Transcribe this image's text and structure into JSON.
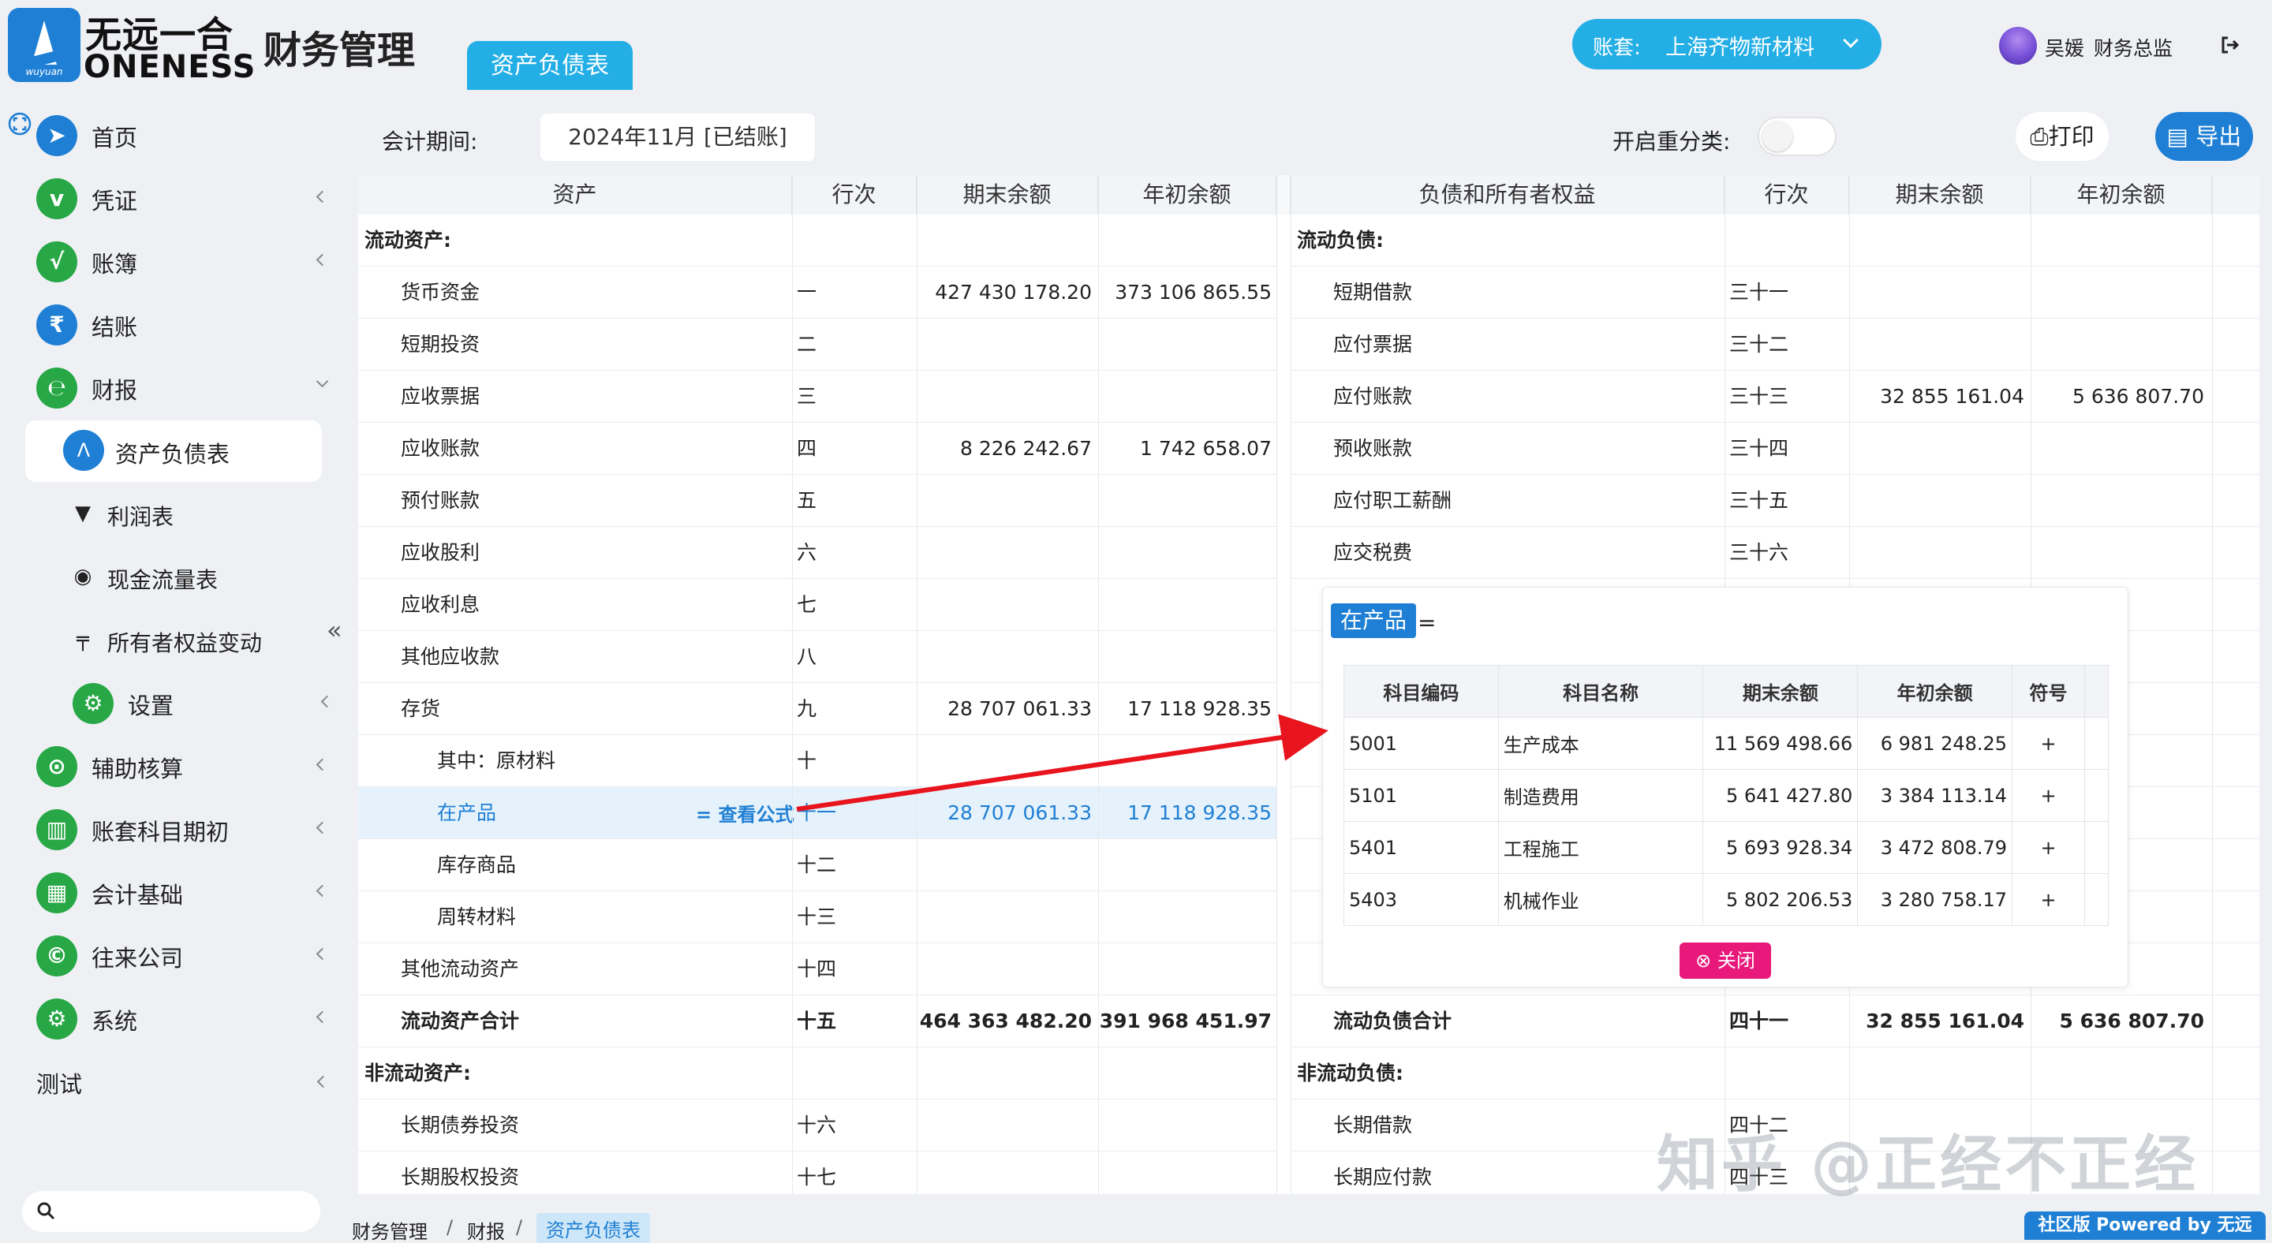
{
  "header": {
    "logo_cn": "无远一合",
    "logo_en": "ONENESS",
    "logo_sub": "wuyuan",
    "app_title": "财务管理",
    "active_tab": "资产负债表",
    "account_label": "账套:",
    "account_value": "上海齐物新材料",
    "user_name": "吴媛",
    "user_role": "财务总监"
  },
  "sidebar": {
    "items": [
      {
        "label": "首页",
        "icon": "navigation-icon"
      },
      {
        "label": "凭证",
        "icon": "voucher-icon"
      },
      {
        "label": "账簿",
        "icon": "ledger-icon"
      },
      {
        "label": "结账",
        "icon": "rupee-icon"
      },
      {
        "label": "财报",
        "icon": "report-icon"
      }
    ],
    "report_children": [
      {
        "label": "资产负债表"
      },
      {
        "label": "利润表"
      },
      {
        "label": "现金流量表"
      },
      {
        "label": "所有者权益变动"
      },
      {
        "label": "设置"
      }
    ],
    "lower_items": [
      {
        "label": "辅助核算"
      },
      {
        "label": "账套科目期初"
      },
      {
        "label": "会计基础"
      },
      {
        "label": "往来公司"
      },
      {
        "label": "系统"
      }
    ],
    "test_label": "测试"
  },
  "toolbar": {
    "period_label": "会计期间:",
    "period_value": "2024年11月 [已结账]",
    "reclass_label": "开启重分类:",
    "print_label": "打印",
    "export_label": "导出"
  },
  "table": {
    "left_headers": [
      "资产",
      "行次",
      "期末余额",
      "年初余额"
    ],
    "right_headers": [
      "负债和所有者权益",
      "行次",
      "期末余额",
      "年初余额"
    ],
    "left_rows": [
      {
        "name": "流动资产:",
        "line": "",
        "end": "",
        "begin": "",
        "section": true
      },
      {
        "name": "货币资金",
        "line": "一",
        "end": "427 430 178.20",
        "begin": "373 106 865.55"
      },
      {
        "name": "短期投资",
        "line": "二",
        "end": "",
        "begin": ""
      },
      {
        "name": "应收票据",
        "line": "三",
        "end": "",
        "begin": ""
      },
      {
        "name": "应收账款",
        "line": "四",
        "end": "8 226 242.67",
        "begin": "1 742 658.07"
      },
      {
        "name": "预付账款",
        "line": "五",
        "end": "",
        "begin": ""
      },
      {
        "name": "应收股利",
        "line": "六",
        "end": "",
        "begin": ""
      },
      {
        "name": "应收利息",
        "line": "七",
        "end": "",
        "begin": ""
      },
      {
        "name": "其他应收款",
        "line": "八",
        "end": "",
        "begin": ""
      },
      {
        "name": "存货",
        "line": "九",
        "end": "28 707 061.33",
        "begin": "17 118 928.35"
      },
      {
        "name": "其中：原材料",
        "line": "十",
        "end": "",
        "begin": "",
        "indent": 2
      },
      {
        "name": "在产品",
        "line": "十一",
        "end": "28 707 061.33",
        "begin": "17 118 928.35",
        "indent": 2,
        "highlight": true
      },
      {
        "name": "库存商品",
        "line": "十二",
        "end": "",
        "begin": "",
        "indent": 2
      },
      {
        "name": "周转材料",
        "line": "十三",
        "end": "",
        "begin": "",
        "indent": 2
      },
      {
        "name": "其他流动资产",
        "line": "十四",
        "end": "",
        "begin": ""
      },
      {
        "name": "流动资产合计",
        "line": "十五",
        "end": "464 363 482.20",
        "begin": "391 968 451.97",
        "bold": true
      },
      {
        "name": "非流动资产:",
        "line": "",
        "end": "",
        "begin": "",
        "section": true
      },
      {
        "name": "长期债券投资",
        "line": "十六",
        "end": "",
        "begin": ""
      },
      {
        "name": "长期股权投资",
        "line": "十七",
        "end": "",
        "begin": ""
      }
    ],
    "right_rows": [
      {
        "name": "流动负债:",
        "line": "",
        "end": "",
        "begin": "",
        "section": true
      },
      {
        "name": "短期借款",
        "line": "三十一",
        "end": "",
        "begin": ""
      },
      {
        "name": "应付票据",
        "line": "三十二",
        "end": "",
        "begin": ""
      },
      {
        "name": "应付账款",
        "line": "三十三",
        "end": "32 855 161.04",
        "begin": "5 636 807.70"
      },
      {
        "name": "预收账款",
        "line": "三十四",
        "end": "",
        "begin": ""
      },
      {
        "name": "应付职工薪酬",
        "line": "三十五",
        "end": "",
        "begin": ""
      },
      {
        "name": "应交税费",
        "line": "三十六",
        "end": "",
        "begin": ""
      },
      {
        "name": "",
        "line": "",
        "end": "",
        "begin": ""
      },
      {
        "name": "",
        "line": "",
        "end": "",
        "begin": ""
      },
      {
        "name": "",
        "line": "",
        "end": "",
        "begin": ""
      },
      {
        "name": "",
        "line": "",
        "end": "",
        "begin": ""
      },
      {
        "name": "",
        "line": "",
        "end": "",
        "begin": ""
      },
      {
        "name": "",
        "line": "",
        "end": "",
        "begin": ""
      },
      {
        "name": "",
        "line": "",
        "end": "",
        "begin": ""
      },
      {
        "name": "",
        "line": "",
        "end": "",
        "begin": ""
      },
      {
        "name": "流动负债合计",
        "line": "四十一",
        "end": "32 855 161.04",
        "begin": "5 636 807.70",
        "bold": true
      },
      {
        "name": "非流动负债:",
        "line": "",
        "end": "",
        "begin": "",
        "section": true
      },
      {
        "name": "长期借款",
        "line": "四十二",
        "end": "",
        "begin": ""
      },
      {
        "name": "长期应付款",
        "line": "四十三",
        "end": "",
        "begin": ""
      }
    ],
    "formula_link": "= 查看公式"
  },
  "popup": {
    "title": "在产品",
    "equals": "=",
    "headers": [
      "科目编码",
      "科目名称",
      "期末余额",
      "年初余额",
      "符号"
    ],
    "rows": [
      {
        "code": "5001",
        "name": "生产成本",
        "end": "11 569 498.66",
        "begin": "6 981 248.25",
        "sign": "+"
      },
      {
        "code": "5101",
        "name": "制造费用",
        "end": "5 641 427.80",
        "begin": "3 384 113.14",
        "sign": "+"
      },
      {
        "code": "5401",
        "name": "工程施工",
        "end": "5 693 928.34",
        "begin": "3 472 808.79",
        "sign": "+"
      },
      {
        "code": "5403",
        "name": "机械作业",
        "end": "5 802 206.53",
        "begin": "3 280 758.17",
        "sign": "+"
      }
    ],
    "close_label": "关闭"
  },
  "breadcrumb": {
    "items": [
      "财务管理",
      "财报"
    ],
    "separator": "/",
    "current": "资产负债表"
  },
  "watermark": "知乎 @正经不正经",
  "powered_by": "社区版 Powered by 无远",
  "colors": {
    "accent": "#1e7fd4",
    "tab": "#23aee5",
    "green": "#27a745",
    "close": "#e8197a",
    "arrow": "#e8141e"
  }
}
